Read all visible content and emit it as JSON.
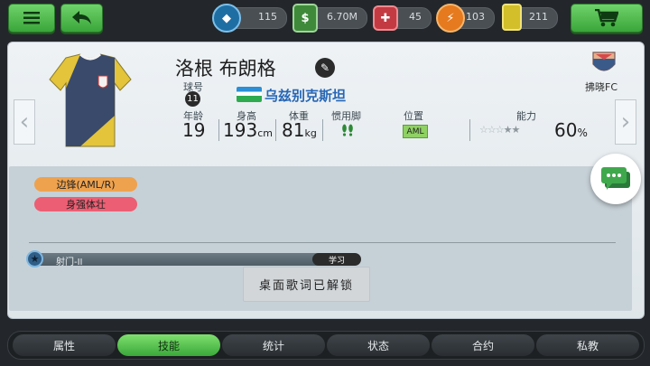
{
  "topbar": {
    "menu_icon": "hamburger-menu-icon",
    "back_icon": "back-arrow-icon",
    "cart_icon": "shopping-cart-icon",
    "resources": [
      {
        "name": "diamonds",
        "icon": "diamond-icon",
        "value": "115",
        "color": "#2a7fb8"
      },
      {
        "name": "cash",
        "icon": "cash-icon",
        "value": "6.70M",
        "color": "#4f9b4a"
      },
      {
        "name": "medical",
        "icon": "medkit-icon",
        "value": "45",
        "color": "#d9464f"
      },
      {
        "name": "energy",
        "icon": "lightning-icon",
        "value": "103",
        "color": "#f08a2a"
      },
      {
        "name": "cards",
        "icon": "card-icon",
        "value": "211",
        "color": "#e6d23a"
      }
    ]
  },
  "player": {
    "name": "洛根 布朗格",
    "jersey_label": "球号",
    "jersey_number": "11",
    "country": "乌兹别克斯坦",
    "club": "拂晓FC",
    "stats": {
      "age_label": "年龄",
      "age": "19",
      "height_label": "身高",
      "height": "193",
      "height_unit": "cm",
      "weight_label": "体重",
      "weight": "81",
      "weight_unit": "kg",
      "foot_label": "惯用脚",
      "position_label": "位置",
      "position": "AML",
      "ability_label": "能力",
      "ability_stars": "★★★★★",
      "ability_pct": "60",
      "ability_unit": "%"
    }
  },
  "traits": [
    {
      "label": "边锋(AML/R)",
      "color": "#eea24e"
    },
    {
      "label": "身强体壮",
      "color": "#ec5e73"
    }
  ],
  "skill": {
    "name": "射门-II",
    "learn_label": "学习"
  },
  "toast": "桌面歌词已解锁",
  "tabs": [
    "属性",
    "技能",
    "统计",
    "状态",
    "合约",
    "私教"
  ],
  "active_tab": "技能"
}
